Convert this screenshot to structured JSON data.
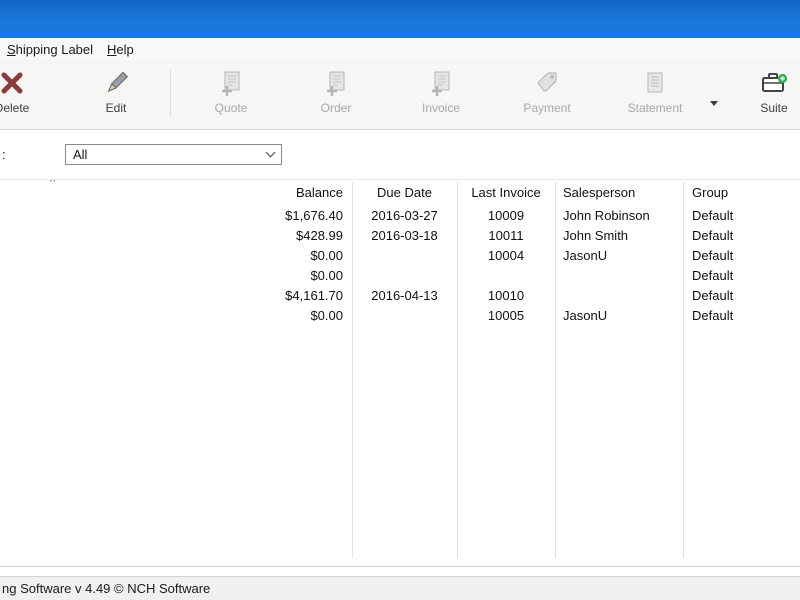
{
  "menu": {
    "items": [
      {
        "label": "Shipping Label"
      },
      {
        "label": "Help"
      }
    ]
  },
  "toolbar": {
    "buttons": [
      {
        "label": "Delete",
        "icon": "delete-x-icon",
        "enabled": true
      },
      {
        "label": "Edit",
        "icon": "edit-pencil-icon",
        "enabled": true
      },
      {
        "label": "Quote",
        "icon": "new-quote-document-icon",
        "enabled": false
      },
      {
        "label": "Order",
        "icon": "new-order-document-icon",
        "enabled": false
      },
      {
        "label": "Invoice",
        "icon": "new-invoice-document-icon",
        "enabled": false
      },
      {
        "label": "Payment",
        "icon": "payment-tag-icon",
        "enabled": false
      },
      {
        "label": "Statement",
        "icon": "statement-document-icon",
        "enabled": false,
        "has_dropdown": true
      },
      {
        "label": "Suite",
        "icon": "suite-briefcase-icon",
        "enabled": true
      }
    ]
  },
  "filter": {
    "label": ":",
    "value": "All"
  },
  "table": {
    "sort_indicator": "^",
    "columns": [
      "Balance",
      "Due Date",
      "Last Invoice",
      "Salesperson",
      "Group"
    ],
    "rows": [
      {
        "balance": "$1,676.40",
        "due_date": "2016-03-27",
        "last_invoice": "10009",
        "salesperson": "John Robinson",
        "group": "Default"
      },
      {
        "balance": "$428.99",
        "due_date": "2016-03-18",
        "last_invoice": "10011",
        "salesperson": "John Smith",
        "group": "Default"
      },
      {
        "balance": "$0.00",
        "due_date": "",
        "last_invoice": "10004",
        "salesperson": "JasonU",
        "group": "Default"
      },
      {
        "balance": "$0.00",
        "due_date": "",
        "last_invoice": "",
        "salesperson": "",
        "group": "Default"
      },
      {
        "balance": "$4,161.70",
        "due_date": "2016-04-13",
        "last_invoice": "10010",
        "salesperson": "",
        "group": "Default"
      },
      {
        "balance": "$0.00",
        "due_date": "",
        "last_invoice": "10005",
        "salesperson": "JasonU",
        "group": "Default"
      }
    ]
  },
  "statusbar": {
    "text": "ng Software v 4.49 © NCH Software"
  },
  "colors": {
    "titlebar_blue": "#1a78dc",
    "accent_green": "#2fae4e",
    "delete_red": "#8a3c3c"
  }
}
